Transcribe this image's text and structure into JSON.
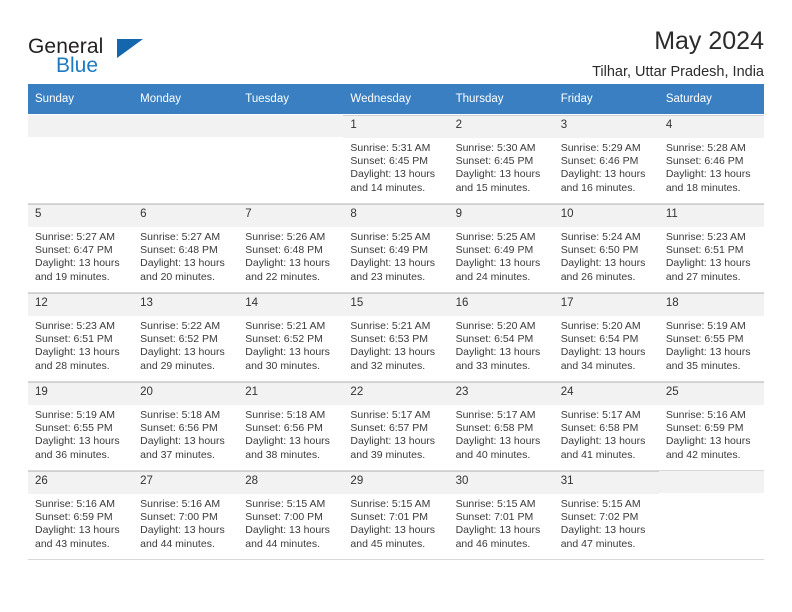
{
  "brand": {
    "name_part1": "General",
    "name_part2": "Blue",
    "logo_icon": "blue-triangle-icon"
  },
  "header": {
    "title": "May 2024",
    "subtitle": "Tilhar, Uttar Pradesh, India"
  },
  "calendar": {
    "weekdays": [
      "Sunday",
      "Monday",
      "Tuesday",
      "Wednesday",
      "Thursday",
      "Friday",
      "Saturday"
    ],
    "header_bg": "#3a7fc1",
    "daynum_bg": "#f2f2f2",
    "weeks": [
      [
        {
          "day": "",
          "sunrise": "",
          "sunset": "",
          "daylight_line1": "",
          "daylight_line2": "",
          "empty": true
        },
        {
          "day": "",
          "sunrise": "",
          "sunset": "",
          "daylight_line1": "",
          "daylight_line2": "",
          "empty": true
        },
        {
          "day": "",
          "sunrise": "",
          "sunset": "",
          "daylight_line1": "",
          "daylight_line2": "",
          "empty": true
        },
        {
          "day": "1",
          "sunrise": "Sunrise: 5:31 AM",
          "sunset": "Sunset: 6:45 PM",
          "daylight_line1": "Daylight: 13 hours",
          "daylight_line2": "and 14 minutes.",
          "empty": false
        },
        {
          "day": "2",
          "sunrise": "Sunrise: 5:30 AM",
          "sunset": "Sunset: 6:45 PM",
          "daylight_line1": "Daylight: 13 hours",
          "daylight_line2": "and 15 minutes.",
          "empty": false
        },
        {
          "day": "3",
          "sunrise": "Sunrise: 5:29 AM",
          "sunset": "Sunset: 6:46 PM",
          "daylight_line1": "Daylight: 13 hours",
          "daylight_line2": "and 16 minutes.",
          "empty": false
        },
        {
          "day": "4",
          "sunrise": "Sunrise: 5:28 AM",
          "sunset": "Sunset: 6:46 PM",
          "daylight_line1": "Daylight: 13 hours",
          "daylight_line2": "and 18 minutes.",
          "empty": false
        }
      ],
      [
        {
          "day": "5",
          "sunrise": "Sunrise: 5:27 AM",
          "sunset": "Sunset: 6:47 PM",
          "daylight_line1": "Daylight: 13 hours",
          "daylight_line2": "and 19 minutes.",
          "empty": false
        },
        {
          "day": "6",
          "sunrise": "Sunrise: 5:27 AM",
          "sunset": "Sunset: 6:48 PM",
          "daylight_line1": "Daylight: 13 hours",
          "daylight_line2": "and 20 minutes.",
          "empty": false
        },
        {
          "day": "7",
          "sunrise": "Sunrise: 5:26 AM",
          "sunset": "Sunset: 6:48 PM",
          "daylight_line1": "Daylight: 13 hours",
          "daylight_line2": "and 22 minutes.",
          "empty": false
        },
        {
          "day": "8",
          "sunrise": "Sunrise: 5:25 AM",
          "sunset": "Sunset: 6:49 PM",
          "daylight_line1": "Daylight: 13 hours",
          "daylight_line2": "and 23 minutes.",
          "empty": false
        },
        {
          "day": "9",
          "sunrise": "Sunrise: 5:25 AM",
          "sunset": "Sunset: 6:49 PM",
          "daylight_line1": "Daylight: 13 hours",
          "daylight_line2": "and 24 minutes.",
          "empty": false
        },
        {
          "day": "10",
          "sunrise": "Sunrise: 5:24 AM",
          "sunset": "Sunset: 6:50 PM",
          "daylight_line1": "Daylight: 13 hours",
          "daylight_line2": "and 26 minutes.",
          "empty": false
        },
        {
          "day": "11",
          "sunrise": "Sunrise: 5:23 AM",
          "sunset": "Sunset: 6:51 PM",
          "daylight_line1": "Daylight: 13 hours",
          "daylight_line2": "and 27 minutes.",
          "empty": false
        }
      ],
      [
        {
          "day": "12",
          "sunrise": "Sunrise: 5:23 AM",
          "sunset": "Sunset: 6:51 PM",
          "daylight_line1": "Daylight: 13 hours",
          "daylight_line2": "and 28 minutes.",
          "empty": false
        },
        {
          "day": "13",
          "sunrise": "Sunrise: 5:22 AM",
          "sunset": "Sunset: 6:52 PM",
          "daylight_line1": "Daylight: 13 hours",
          "daylight_line2": "and 29 minutes.",
          "empty": false
        },
        {
          "day": "14",
          "sunrise": "Sunrise: 5:21 AM",
          "sunset": "Sunset: 6:52 PM",
          "daylight_line1": "Daylight: 13 hours",
          "daylight_line2": "and 30 minutes.",
          "empty": false
        },
        {
          "day": "15",
          "sunrise": "Sunrise: 5:21 AM",
          "sunset": "Sunset: 6:53 PM",
          "daylight_line1": "Daylight: 13 hours",
          "daylight_line2": "and 32 minutes.",
          "empty": false
        },
        {
          "day": "16",
          "sunrise": "Sunrise: 5:20 AM",
          "sunset": "Sunset: 6:54 PM",
          "daylight_line1": "Daylight: 13 hours",
          "daylight_line2": "and 33 minutes.",
          "empty": false
        },
        {
          "day": "17",
          "sunrise": "Sunrise: 5:20 AM",
          "sunset": "Sunset: 6:54 PM",
          "daylight_line1": "Daylight: 13 hours",
          "daylight_line2": "and 34 minutes.",
          "empty": false
        },
        {
          "day": "18",
          "sunrise": "Sunrise: 5:19 AM",
          "sunset": "Sunset: 6:55 PM",
          "daylight_line1": "Daylight: 13 hours",
          "daylight_line2": "and 35 minutes.",
          "empty": false
        }
      ],
      [
        {
          "day": "19",
          "sunrise": "Sunrise: 5:19 AM",
          "sunset": "Sunset: 6:55 PM",
          "daylight_line1": "Daylight: 13 hours",
          "daylight_line2": "and 36 minutes.",
          "empty": false
        },
        {
          "day": "20",
          "sunrise": "Sunrise: 5:18 AM",
          "sunset": "Sunset: 6:56 PM",
          "daylight_line1": "Daylight: 13 hours",
          "daylight_line2": "and 37 minutes.",
          "empty": false
        },
        {
          "day": "21",
          "sunrise": "Sunrise: 5:18 AM",
          "sunset": "Sunset: 6:56 PM",
          "daylight_line1": "Daylight: 13 hours",
          "daylight_line2": "and 38 minutes.",
          "empty": false
        },
        {
          "day": "22",
          "sunrise": "Sunrise: 5:17 AM",
          "sunset": "Sunset: 6:57 PM",
          "daylight_line1": "Daylight: 13 hours",
          "daylight_line2": "and 39 minutes.",
          "empty": false
        },
        {
          "day": "23",
          "sunrise": "Sunrise: 5:17 AM",
          "sunset": "Sunset: 6:58 PM",
          "daylight_line1": "Daylight: 13 hours",
          "daylight_line2": "and 40 minutes.",
          "empty": false
        },
        {
          "day": "24",
          "sunrise": "Sunrise: 5:17 AM",
          "sunset": "Sunset: 6:58 PM",
          "daylight_line1": "Daylight: 13 hours",
          "daylight_line2": "and 41 minutes.",
          "empty": false
        },
        {
          "day": "25",
          "sunrise": "Sunrise: 5:16 AM",
          "sunset": "Sunset: 6:59 PM",
          "daylight_line1": "Daylight: 13 hours",
          "daylight_line2": "and 42 minutes.",
          "empty": false
        }
      ],
      [
        {
          "day": "26",
          "sunrise": "Sunrise: 5:16 AM",
          "sunset": "Sunset: 6:59 PM",
          "daylight_line1": "Daylight: 13 hours",
          "daylight_line2": "and 43 minutes.",
          "empty": false
        },
        {
          "day": "27",
          "sunrise": "Sunrise: 5:16 AM",
          "sunset": "Sunset: 7:00 PM",
          "daylight_line1": "Daylight: 13 hours",
          "daylight_line2": "and 44 minutes.",
          "empty": false
        },
        {
          "day": "28",
          "sunrise": "Sunrise: 5:15 AM",
          "sunset": "Sunset: 7:00 PM",
          "daylight_line1": "Daylight: 13 hours",
          "daylight_line2": "and 44 minutes.",
          "empty": false
        },
        {
          "day": "29",
          "sunrise": "Sunrise: 5:15 AM",
          "sunset": "Sunset: 7:01 PM",
          "daylight_line1": "Daylight: 13 hours",
          "daylight_line2": "and 45 minutes.",
          "empty": false
        },
        {
          "day": "30",
          "sunrise": "Sunrise: 5:15 AM",
          "sunset": "Sunset: 7:01 PM",
          "daylight_line1": "Daylight: 13 hours",
          "daylight_line2": "and 46 minutes.",
          "empty": false
        },
        {
          "day": "31",
          "sunrise": "Sunrise: 5:15 AM",
          "sunset": "Sunset: 7:02 PM",
          "daylight_line1": "Daylight: 13 hours",
          "daylight_line2": "and 47 minutes.",
          "empty": false
        },
        {
          "day": "",
          "sunrise": "",
          "sunset": "",
          "daylight_line1": "",
          "daylight_line2": "",
          "empty": true
        }
      ]
    ]
  }
}
